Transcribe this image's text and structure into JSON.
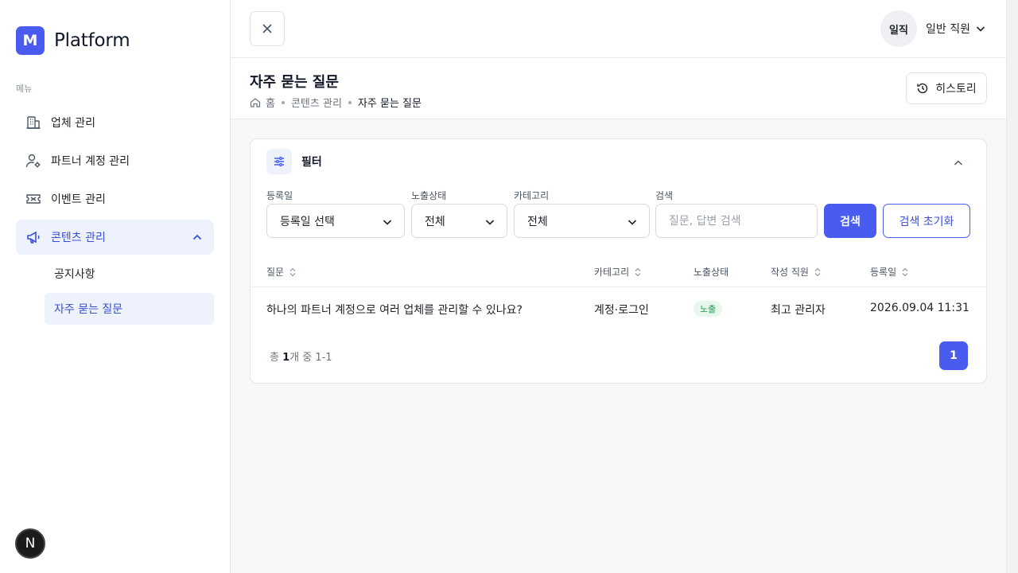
{
  "brand": {
    "logo_letter": "M",
    "name": "Platform"
  },
  "sidebar": {
    "menu_title": "메뉴",
    "items": [
      {
        "label": "업체 관리",
        "icon": "building-icon"
      },
      {
        "label": "파트너 계정 관리",
        "icon": "user-gear-icon"
      },
      {
        "label": "이벤트 관리",
        "icon": "ticket-icon"
      },
      {
        "label": "콘텐츠 관리",
        "icon": "megaphone-icon",
        "expanded": true
      }
    ],
    "sub_items": [
      {
        "label": "공지사항"
      },
      {
        "label": "자주 묻는 질문",
        "active": true
      }
    ],
    "n_badge": "N"
  },
  "topbar": {
    "user_avatar": "일직",
    "user_role": "일반 직원"
  },
  "page": {
    "title": "자주 묻는 질문",
    "breadcrumb": [
      "홈",
      "콘텐츠 관리",
      "자주 묻는 질문"
    ],
    "history_label": "히스토리"
  },
  "filter": {
    "title": "필터",
    "date_label": "등록일",
    "date_value": "등록일 선택",
    "status_label": "노출상태",
    "status_value": "전체",
    "category_label": "카테고리",
    "category_value": "전체",
    "search_label": "검색",
    "search_placeholder": "질문, 답변 검색",
    "search_button": "검색",
    "reset_button": "검색 초기화"
  },
  "table": {
    "headers": [
      "질문",
      "카테고리",
      "노출상태",
      "작성 직원",
      "등록일"
    ],
    "rows": [
      {
        "question": "하나의 파트너 계정으로 여러 업체를 관리할 수 있나요?",
        "category": "계정·로그인",
        "status": "노출",
        "author": "최고 관리자",
        "date": "2026.09.04 11:31"
      }
    ]
  },
  "pagination": {
    "total_prefix": "총 ",
    "total_count": "1",
    "total_suffix": "개 중 1-1",
    "current_page": "1"
  },
  "colors": {
    "accent": "#4a5cf0",
    "active_bg": "#eef2fd",
    "status_green": "#1a9a4d"
  }
}
